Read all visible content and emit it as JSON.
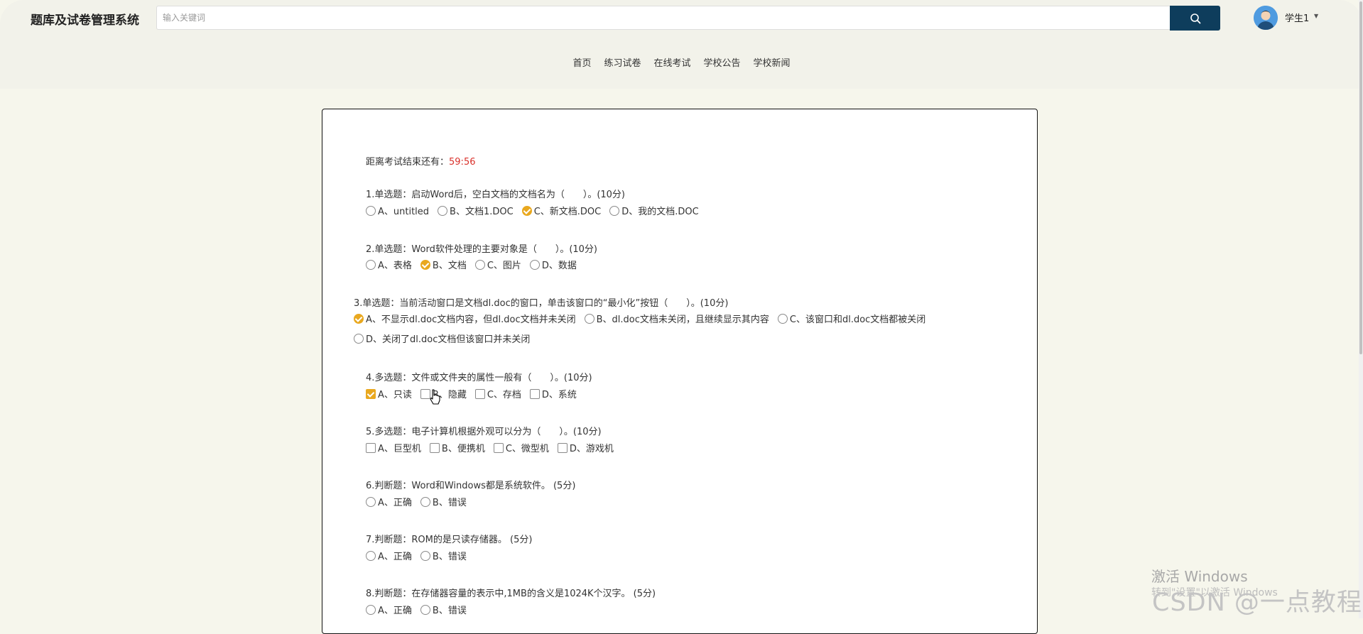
{
  "header": {
    "site_title": "题库及试卷管理系统",
    "search": {
      "placeholder": "输入关键词",
      "value": ""
    },
    "search_button_icon": "search-icon",
    "user": {
      "name": "学生1",
      "avatar_icon": "user-avatar-icon",
      "caret_icon": "caret-down-icon"
    }
  },
  "nav": {
    "items": [
      "首页",
      "练习试卷",
      "在线考试",
      "学校公告",
      "学校新闻"
    ]
  },
  "exam": {
    "timer_label": "距离考试结束还有：",
    "timer_value": "59:56",
    "questions": [
      {
        "title": "1.单选题：启动Word后，空白文档的文档名为（　　）。(10分)",
        "kind": "radio",
        "options": [
          "A、untitled",
          "B、文档1.DOC",
          "C、新文档.DOC",
          "D、我的文档.DOC"
        ],
        "selected": [
          false,
          false,
          true,
          false
        ]
      },
      {
        "title": "2.单选题：Word软件处理的主要对象是（　　）。(10分)",
        "kind": "radio",
        "options": [
          "A、表格",
          "B、文档",
          "C、图片",
          "D、数据"
        ],
        "selected": [
          false,
          true,
          false,
          false
        ]
      },
      {
        "title": "3.单选题：当前活动窗口是文档dl.doc的窗口，单击该窗口的“最小化”按钮（　　）。(10分)",
        "kind": "radio",
        "options": [
          "A、不显示dl.doc文档内容，但dl.doc文档并未关闭",
          "B、dl.doc文档未关闭，且继续显示其内容",
          "C、该窗口和dl.doc文档都被关闭",
          "D、关闭了dl.doc文档但该窗口并未关闭"
        ],
        "selected": [
          true,
          false,
          false,
          false
        ]
      },
      {
        "title": "4.多选题：文件或文件夹的属性一般有（　　）。(10分)",
        "kind": "checkbox",
        "options": [
          "A、只读",
          "B、隐藏",
          "C、存档",
          "D、系统"
        ],
        "selected": [
          true,
          false,
          false,
          false
        ]
      },
      {
        "title": "5.多选题：电子计算机根据外观可以分为（　　）。(10分)",
        "kind": "checkbox",
        "options": [
          "A、巨型机",
          "B、便携机",
          "C、微型机",
          "D、游戏机"
        ],
        "selected": [
          false,
          false,
          false,
          false
        ]
      },
      {
        "title": "6.判断题：Word和Windows都是系统软件。 (5分)",
        "kind": "radio",
        "options": [
          "A、正确",
          "B、错误"
        ],
        "selected": [
          false,
          false
        ]
      },
      {
        "title": "7.判断题：ROM的是只读存储器。 (5分)",
        "kind": "radio",
        "options": [
          "A、正确",
          "B、错误"
        ],
        "selected": [
          false,
          false
        ]
      },
      {
        "title": "8.判断题：在存储器容量的表示中,1MB的含义是1024K个汉字。 (5分)",
        "kind": "radio",
        "options": [
          "A、正确",
          "B、错误"
        ],
        "selected": [
          false,
          false
        ]
      }
    ]
  },
  "watermark": {
    "windows_line": "激活 Windows",
    "windows_sub": "转到\"设置\"以激活 Windows",
    "csdn": "CSDN @一点教程"
  },
  "colors": {
    "accent": "#e9a81f",
    "search_button": "#0e3d5c",
    "timer": "#d9312b",
    "page_bg": "#f6f6ec"
  }
}
